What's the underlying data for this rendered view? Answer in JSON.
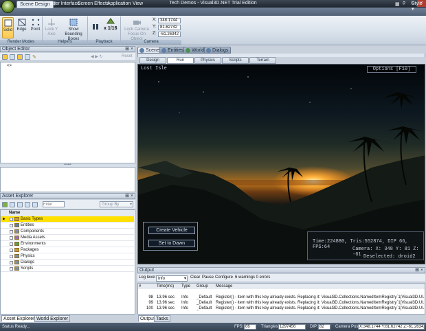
{
  "app": {
    "title": "Tech Demos - Visual3D.NET Trial Edition",
    "style_menu": "Style"
  },
  "ribbon_tabs": [
    "Scene Design",
    "User Interface",
    "Screen Effects",
    "Application",
    "View"
  ],
  "ribbon": {
    "render_modes": {
      "label": "Render Modes",
      "buttons": [
        "Solid",
        "Edge",
        "Point"
      ]
    },
    "helpers": {
      "label": "Helpers",
      "lock_y_axis": "Lock Y Axis",
      "show_bounding_boxes": "Show Bounding Boxes"
    },
    "playback": {
      "label": "Playback",
      "speed": "x 1/16"
    },
    "camera": {
      "label": "Camera",
      "lock_focus": "Lock Camera Focus On Object",
      "x_label": "X:",
      "y_label": "Y:",
      "z_label": "Z:",
      "x": "348.1744",
      "y": "81.62742",
      "z": "-61.26342"
    }
  },
  "object_editor": {
    "title": "Object Editor",
    "reset": "Reset",
    "node": "<>"
  },
  "asset_explorer": {
    "title": "Asset Explorer",
    "filter_placeholder": "Filter",
    "group_by": "Group By",
    "column": "Name",
    "rows": [
      "Basic Types",
      "Entities",
      "Components",
      "Media Assets",
      "Environments",
      "Packages",
      "Physics",
      "Dialogs",
      "Scripts"
    ]
  },
  "left_tabs": [
    "Asset Explorer",
    "World Explorer"
  ],
  "view_tabs": [
    "Scene",
    "Entities",
    "World",
    "Dialogs"
  ],
  "scene_tabs": [
    "Design",
    "Run",
    "Physics",
    "Scripts",
    "Terrain"
  ],
  "scene": {
    "name": "Lost Isle",
    "options": "Options [F10]",
    "btn_create": "Create Vehicle",
    "btn_dawn": "Set to Dawn",
    "stats1": "Time:224880, Tris:552874, DIP 66, FPS:64",
    "stats2": "Camera: X: 348 Y: 81 Z: -61",
    "stats3": "Deselected: droid2"
  },
  "output": {
    "title": "Output",
    "log_level_label": "Log level",
    "log_level": "Info",
    "clear": "Clear",
    "pause": "Pause",
    "configure": "Configure",
    "summary": "6 warnings 0 errors",
    "columns": [
      "#",
      "Time(ms)",
      "Type",
      "Group",
      "Message"
    ],
    "rows": [
      {
        "n": "98",
        "t": "13.96 sec",
        "type": "Info",
        "group": "_Default",
        "msg": "Register() - item with this key already exists. Replacing it: Visual3D.Collections.NamedItemRegistry`1[Visual3D.UI.IGuiFor..."
      },
      {
        "n": "99",
        "t": "13.96 sec",
        "type": "Info",
        "group": "_Default",
        "msg": "Register() - item with this key already exists. Replacing it: Visual3D.Collections.NamedItemRegistry`1[Visual3D.UI.IGuiFor..."
      },
      {
        "n": "100",
        "t": "13.96 sec",
        "type": "Info",
        "group": "_Default",
        "msg": "Register() - item with this key already exists. Replacing it: Visual3D.Collections.NamedItemRegistry`1[Visual3D.UI.IGuiFor..."
      }
    ]
  },
  "bottom_tabs": [
    "Output",
    "Tasks"
  ],
  "status": {
    "text": "Status Ready...",
    "fps_label": "FPS:",
    "fps": "66",
    "tris_label": "Triangles:",
    "tris": "1297456",
    "dip_label": "DIP:",
    "dip": "82",
    "cam_label": "Camera Pos:",
    "cam": "X:348.1744 Y:81.62742 Z:-61.26342"
  },
  "colors": {
    "accent": "#ffc94f",
    "selected_row": "#ffe000",
    "titlebar": "#2a323d"
  }
}
